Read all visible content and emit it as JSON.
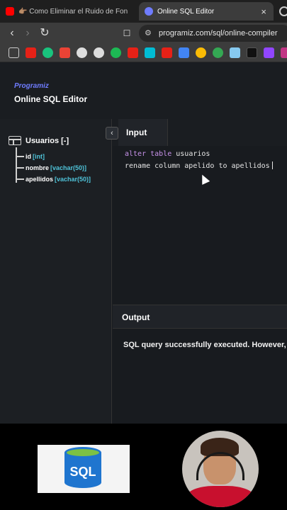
{
  "browser": {
    "tabs": [
      {
        "title": "👉🏽 Como Eliminar el Ruido de Fon",
        "active": false
      },
      {
        "title": "Online SQL Editor",
        "active": true,
        "close": "×"
      }
    ],
    "url": "programiz.com/sql/online-compiler",
    "bookmark_icons": [
      "youtube-icon",
      "chatgpt-icon",
      "gmail-icon",
      "github-icon",
      "github-icon-2",
      "spotify-icon",
      "youtube-icon-2",
      "hubspot-icon",
      "youtube-icon-3",
      "drive-icon",
      "photos-icon",
      "chrome-icon",
      "vimeo-icon",
      "tiktok-icon",
      "twitch-icon",
      "instagram-icon"
    ]
  },
  "app": {
    "brand": "Programiz",
    "title": "Online SQL Editor",
    "schema": {
      "table_label": "Usuarios [-]",
      "columns": [
        {
          "name": "id",
          "type": "[int]"
        },
        {
          "name": "nombre",
          "type": "[vachar(50)]"
        },
        {
          "name": "apellidos",
          "type": "[vachar(50)]"
        }
      ]
    },
    "collapse_symbol": "‹",
    "input_tab": "Input",
    "editor": {
      "line1_kw": "alter table",
      "line1_rest": " usuarios",
      "line2": "rename column apelido to apellidos"
    },
    "output_label": "Output",
    "output_text": "SQL query successfully executed. However, the result set is empty."
  },
  "overlay": {
    "sql_logo_text": "SQL"
  },
  "colors": {
    "accent": "#6f7cff",
    "type_color": "#4fc3d9",
    "keyword": "#c792ea",
    "background": "#181b1f"
  }
}
